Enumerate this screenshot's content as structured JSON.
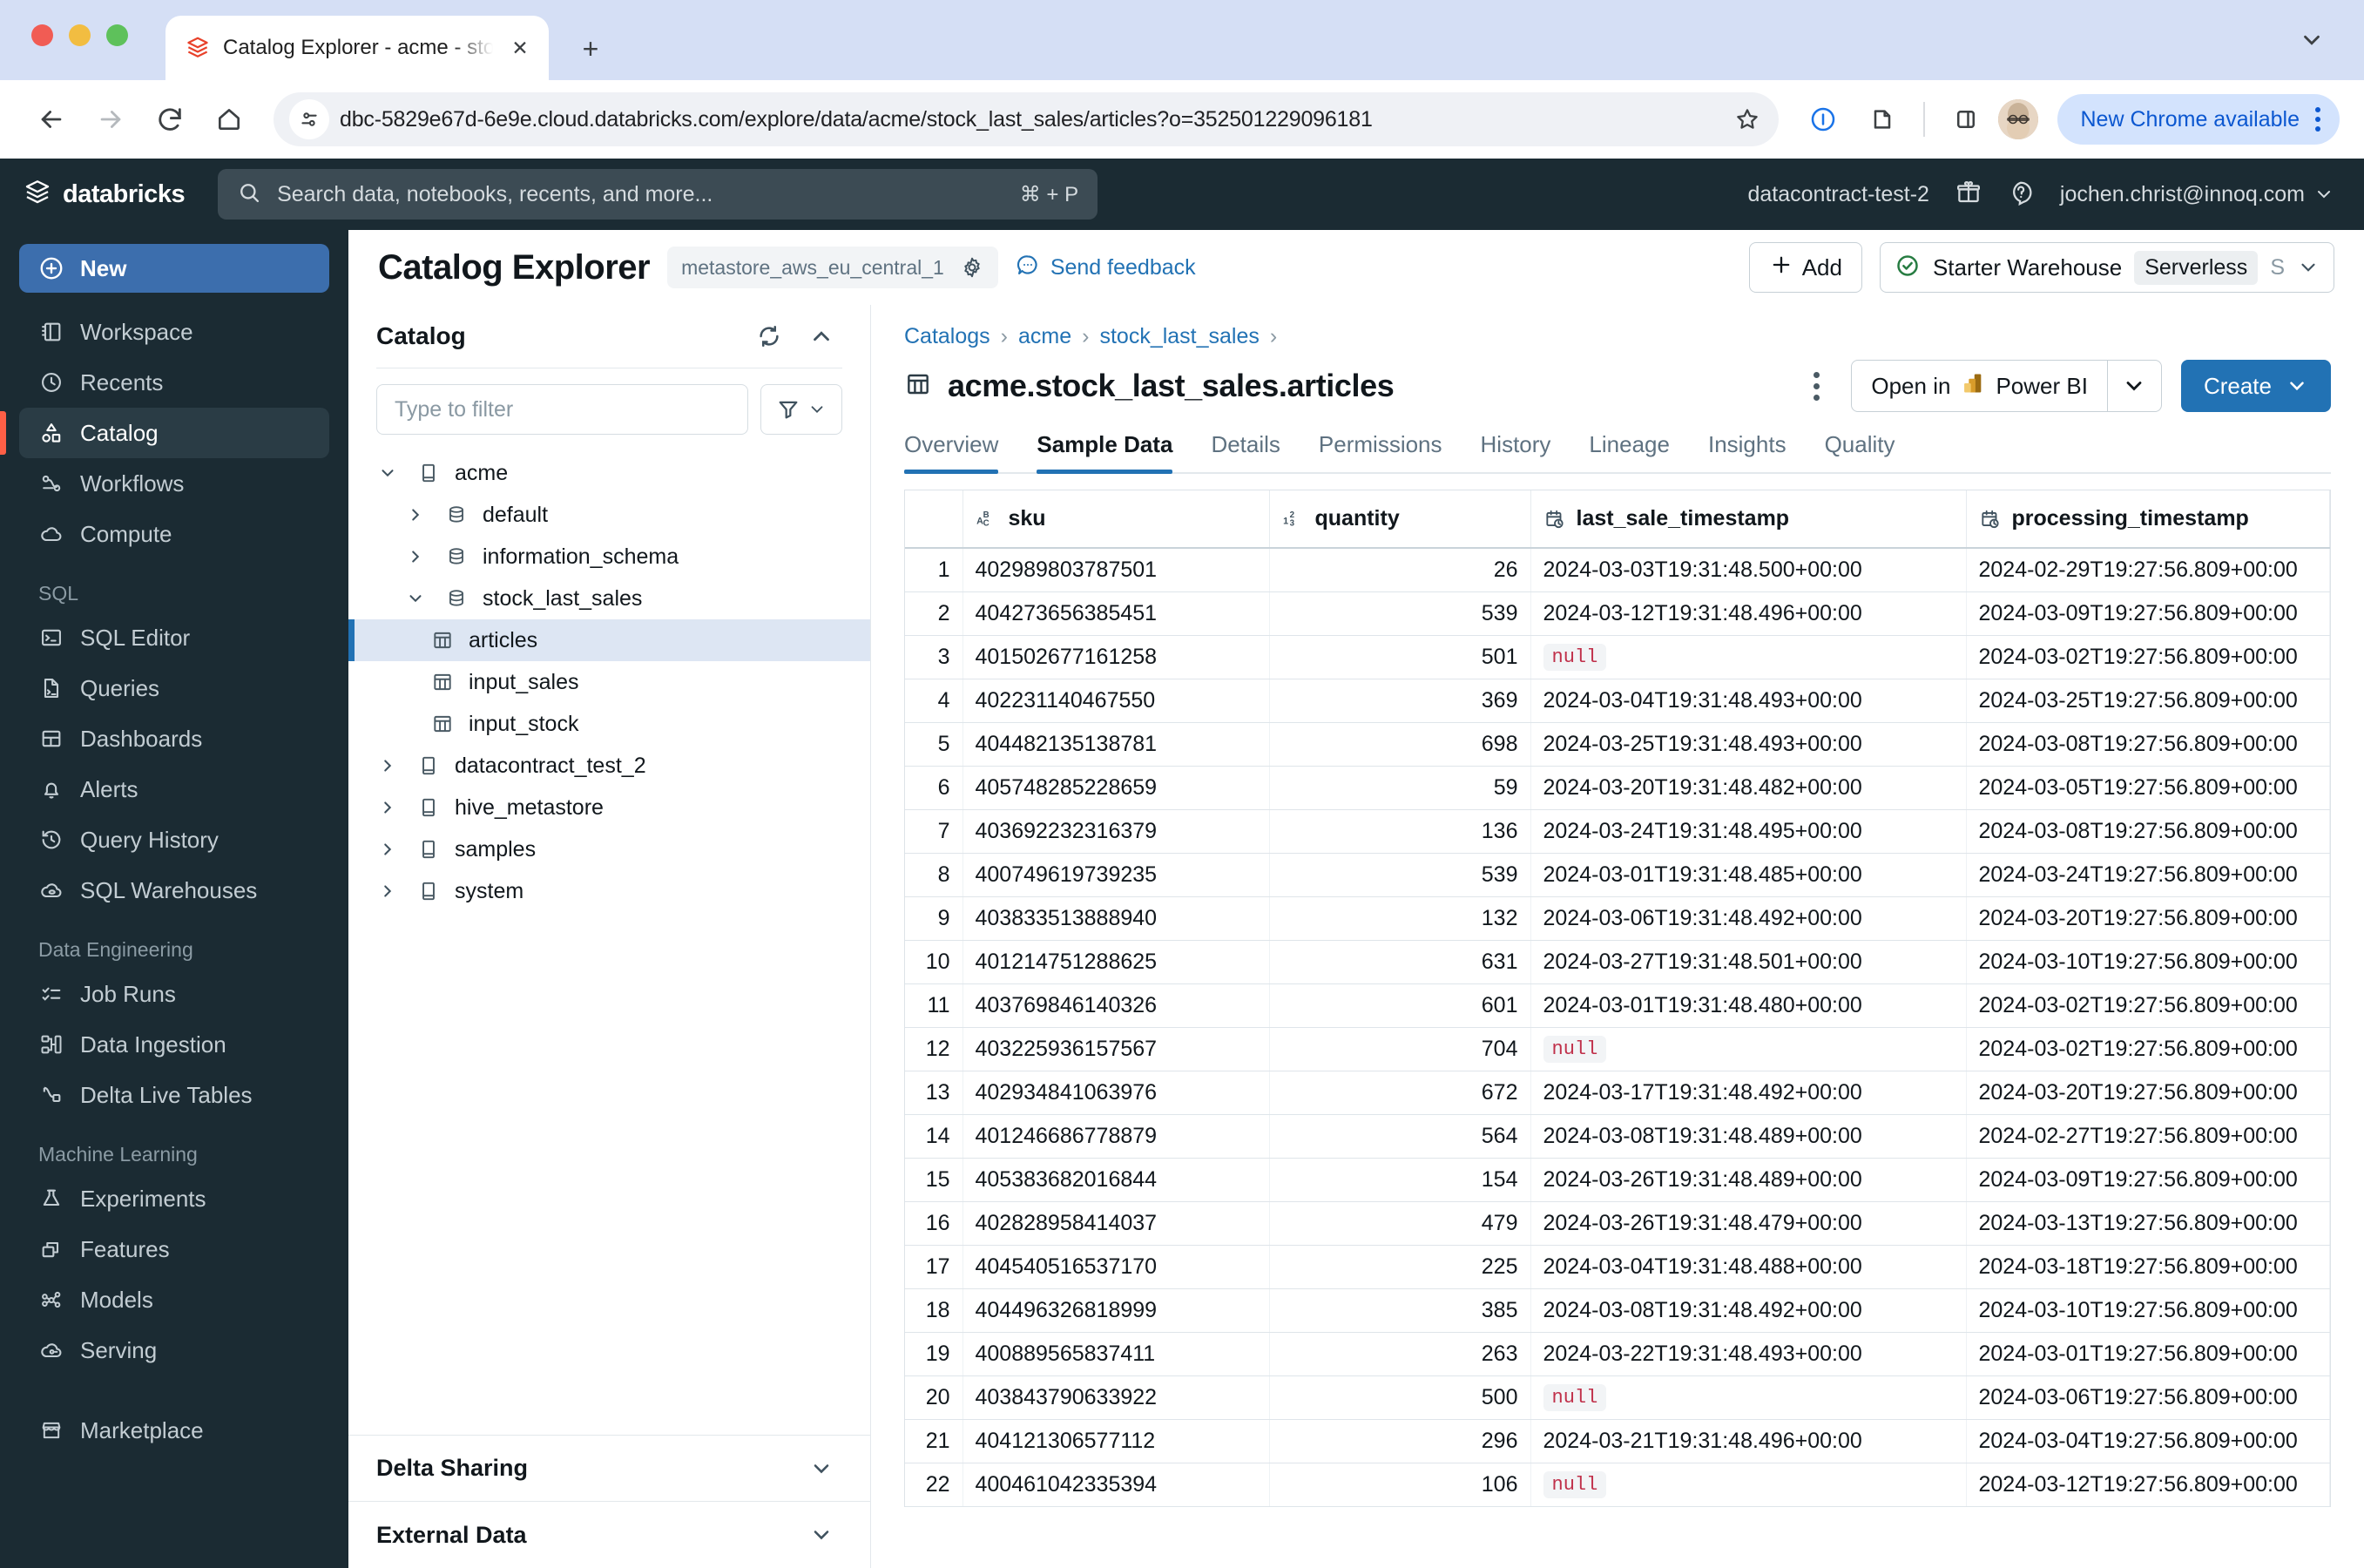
{
  "browser": {
    "tab_title": "Catalog Explorer - acme - sto",
    "new_tab_label": "+",
    "close_label": "✕",
    "url": "dbc-5829e67d-6e9e.cloud.databricks.com/explore/data/acme/stock_last_sales/articles?o=352501229096181",
    "update_label": "New Chrome available"
  },
  "topbar": {
    "brand": "databricks",
    "search_placeholder": "Search data, notebooks, recents, and more...",
    "search_shortcut": "⌘ + P",
    "workspace": "datacontract-test-2",
    "user": "jochen.christ@innoq.com"
  },
  "sidebar": {
    "new_label": "New",
    "items": [
      {
        "label": "Workspace",
        "icon": "workspace-icon",
        "active": false
      },
      {
        "label": "Recents",
        "icon": "clock-icon",
        "active": false
      },
      {
        "label": "Catalog",
        "icon": "catalog-icon",
        "active": true
      },
      {
        "label": "Workflows",
        "icon": "workflows-icon",
        "active": false
      },
      {
        "label": "Compute",
        "icon": "cloud-icon",
        "active": false
      }
    ],
    "groups": [
      {
        "title": "SQL",
        "items": [
          {
            "label": "SQL Editor",
            "icon": "terminal-icon"
          },
          {
            "label": "Queries",
            "icon": "query-file-icon"
          },
          {
            "label": "Dashboards",
            "icon": "dashboard-icon"
          },
          {
            "label": "Alerts",
            "icon": "bell-icon"
          },
          {
            "label": "Query History",
            "icon": "history-icon"
          },
          {
            "label": "SQL Warehouses",
            "icon": "warehouse-icon"
          }
        ]
      },
      {
        "title": "Data Engineering",
        "items": [
          {
            "label": "Job Runs",
            "icon": "checklist-icon"
          },
          {
            "label": "Data Ingestion",
            "icon": "ingestion-icon"
          },
          {
            "label": "Delta Live Tables",
            "icon": "delta-icon"
          }
        ]
      },
      {
        "title": "Machine Learning",
        "items": [
          {
            "label": "Experiments",
            "icon": "experiment-icon"
          },
          {
            "label": "Features",
            "icon": "features-icon"
          },
          {
            "label": "Models",
            "icon": "models-icon"
          },
          {
            "label": "Serving",
            "icon": "serving-icon"
          }
        ]
      },
      {
        "title": "",
        "items": [
          {
            "label": "Marketplace",
            "icon": "marketplace-icon"
          }
        ]
      }
    ]
  },
  "page": {
    "title": "Catalog Explorer",
    "metastore": "metastore_aws_eu_central_1",
    "feedback_label": "Send feedback",
    "add_label": "Add",
    "warehouse_name": "Starter Warehouse",
    "warehouse_badge": "Serverless",
    "warehouse_size": "S"
  },
  "catalog_panel": {
    "title": "Catalog",
    "filter_placeholder": "Type to filter",
    "tree": [
      {
        "label": "acme",
        "level": 0,
        "icon": "catalog-book-icon",
        "twisty": "down",
        "selected": false
      },
      {
        "label": "default",
        "level": 1,
        "icon": "schema-icon",
        "twisty": "right",
        "selected": false
      },
      {
        "label": "information_schema",
        "level": 1,
        "icon": "schema-icon",
        "twisty": "right",
        "selected": false
      },
      {
        "label": "stock_last_sales",
        "level": 1,
        "icon": "schema-icon",
        "twisty": "down",
        "selected": false
      },
      {
        "label": "articles",
        "level": 2,
        "icon": "table-icon",
        "twisty": "none",
        "selected": true
      },
      {
        "label": "input_sales",
        "level": 2,
        "icon": "table-icon",
        "twisty": "none",
        "selected": false
      },
      {
        "label": "input_stock",
        "level": 2,
        "icon": "table-icon",
        "twisty": "none",
        "selected": false
      },
      {
        "label": "datacontract_test_2",
        "level": 0,
        "icon": "catalog-book-icon",
        "twisty": "right",
        "selected": false
      },
      {
        "label": "hive_metastore",
        "level": 0,
        "icon": "catalog-book-icon",
        "twisty": "right",
        "selected": false
      },
      {
        "label": "samples",
        "level": 0,
        "icon": "catalog-book-icon",
        "twisty": "right",
        "selected": false
      },
      {
        "label": "system",
        "level": 0,
        "icon": "catalog-book-icon",
        "twisty": "right",
        "selected": false
      }
    ],
    "footer": [
      {
        "label": "Delta Sharing"
      },
      {
        "label": "External Data"
      }
    ]
  },
  "detail": {
    "breadcrumb": [
      "Catalogs",
      "acme",
      "stock_last_sales"
    ],
    "table_title": "acme.stock_last_sales.articles",
    "open_in_label": "Open in",
    "open_in_target": "Power BI",
    "create_label": "Create",
    "tabs": [
      {
        "label": "Overview",
        "active": false
      },
      {
        "label": "Sample Data",
        "active": true
      },
      {
        "label": "Details",
        "active": false
      },
      {
        "label": "Permissions",
        "active": false
      },
      {
        "label": "History",
        "active": false
      },
      {
        "label": "Lineage",
        "active": false
      },
      {
        "label": "Insights",
        "active": false
      },
      {
        "label": "Quality",
        "active": false
      }
    ],
    "grid": {
      "columns": [
        {
          "name": "sku",
          "type_icon": "string-type-icon",
          "align": "left"
        },
        {
          "name": "quantity",
          "type_icon": "number-type-icon",
          "align": "right"
        },
        {
          "name": "last_sale_timestamp",
          "type_icon": "timestamp-type-icon",
          "align": "left"
        },
        {
          "name": "processing_timestamp",
          "type_icon": "timestamp-type-icon",
          "align": "left"
        }
      ],
      "null_label": "null",
      "rows": [
        {
          "n": "1",
          "sku": "402989803787501",
          "quantity": "26",
          "last_sale_timestamp": "2024-03-03T19:31:48.500+00:00",
          "processing_timestamp": "2024-02-29T19:27:56.809+00:00"
        },
        {
          "n": "2",
          "sku": "404273656385451",
          "quantity": "539",
          "last_sale_timestamp": "2024-03-12T19:31:48.496+00:00",
          "processing_timestamp": "2024-03-09T19:27:56.809+00:00"
        },
        {
          "n": "3",
          "sku": "401502677161258",
          "quantity": "501",
          "last_sale_timestamp": null,
          "processing_timestamp": "2024-03-02T19:27:56.809+00:00"
        },
        {
          "n": "4",
          "sku": "402231140467550",
          "quantity": "369",
          "last_sale_timestamp": "2024-03-04T19:31:48.493+00:00",
          "processing_timestamp": "2024-03-25T19:27:56.809+00:00"
        },
        {
          "n": "5",
          "sku": "404482135138781",
          "quantity": "698",
          "last_sale_timestamp": "2024-03-25T19:31:48.493+00:00",
          "processing_timestamp": "2024-03-08T19:27:56.809+00:00"
        },
        {
          "n": "6",
          "sku": "405748285228659",
          "quantity": "59",
          "last_sale_timestamp": "2024-03-20T19:31:48.482+00:00",
          "processing_timestamp": "2024-03-05T19:27:56.809+00:00"
        },
        {
          "n": "7",
          "sku": "403692232316379",
          "quantity": "136",
          "last_sale_timestamp": "2024-03-24T19:31:48.495+00:00",
          "processing_timestamp": "2024-03-08T19:27:56.809+00:00"
        },
        {
          "n": "8",
          "sku": "400749619739235",
          "quantity": "539",
          "last_sale_timestamp": "2024-03-01T19:31:48.485+00:00",
          "processing_timestamp": "2024-03-24T19:27:56.809+00:00"
        },
        {
          "n": "9",
          "sku": "403833513888940",
          "quantity": "132",
          "last_sale_timestamp": "2024-03-06T19:31:48.492+00:00",
          "processing_timestamp": "2024-03-20T19:27:56.809+00:00"
        },
        {
          "n": "10",
          "sku": "401214751288625",
          "quantity": "631",
          "last_sale_timestamp": "2024-03-27T19:31:48.501+00:00",
          "processing_timestamp": "2024-03-10T19:27:56.809+00:00"
        },
        {
          "n": "11",
          "sku": "403769846140326",
          "quantity": "601",
          "last_sale_timestamp": "2024-03-01T19:31:48.480+00:00",
          "processing_timestamp": "2024-03-02T19:27:56.809+00:00"
        },
        {
          "n": "12",
          "sku": "403225936157567",
          "quantity": "704",
          "last_sale_timestamp": null,
          "processing_timestamp": "2024-03-02T19:27:56.809+00:00"
        },
        {
          "n": "13",
          "sku": "402934841063976",
          "quantity": "672",
          "last_sale_timestamp": "2024-03-17T19:31:48.492+00:00",
          "processing_timestamp": "2024-03-20T19:27:56.809+00:00"
        },
        {
          "n": "14",
          "sku": "401246686778879",
          "quantity": "564",
          "last_sale_timestamp": "2024-03-08T19:31:48.489+00:00",
          "processing_timestamp": "2024-02-27T19:27:56.809+00:00"
        },
        {
          "n": "15",
          "sku": "405383682016844",
          "quantity": "154",
          "last_sale_timestamp": "2024-03-26T19:31:48.489+00:00",
          "processing_timestamp": "2024-03-09T19:27:56.809+00:00"
        },
        {
          "n": "16",
          "sku": "402828958414037",
          "quantity": "479",
          "last_sale_timestamp": "2024-03-26T19:31:48.479+00:00",
          "processing_timestamp": "2024-03-13T19:27:56.809+00:00"
        },
        {
          "n": "17",
          "sku": "404540516537170",
          "quantity": "225",
          "last_sale_timestamp": "2024-03-04T19:31:48.488+00:00",
          "processing_timestamp": "2024-03-18T19:27:56.809+00:00"
        },
        {
          "n": "18",
          "sku": "404496326818999",
          "quantity": "385",
          "last_sale_timestamp": "2024-03-08T19:31:48.492+00:00",
          "processing_timestamp": "2024-03-10T19:27:56.809+00:00"
        },
        {
          "n": "19",
          "sku": "400889565837411",
          "quantity": "263",
          "last_sale_timestamp": "2024-03-22T19:31:48.493+00:00",
          "processing_timestamp": "2024-03-01T19:27:56.809+00:00"
        },
        {
          "n": "20",
          "sku": "403843790633922",
          "quantity": "500",
          "last_sale_timestamp": null,
          "processing_timestamp": "2024-03-06T19:27:56.809+00:00"
        },
        {
          "n": "21",
          "sku": "404121306577112",
          "quantity": "296",
          "last_sale_timestamp": "2024-03-21T19:31:48.496+00:00",
          "processing_timestamp": "2024-03-04T19:27:56.809+00:00"
        },
        {
          "n": "22",
          "sku": "400461042335394",
          "quantity": "106",
          "last_sale_timestamp": null,
          "processing_timestamp": "2024-03-12T19:27:56.809+00:00"
        }
      ]
    }
  },
  "colors": {
    "accent": "#2272b4",
    "nav_bg": "#1b2b33",
    "nav_active_mark": "#ff5f46",
    "null_text": "#c0304a",
    "chrome_update_bg": "#d3e3fd"
  }
}
